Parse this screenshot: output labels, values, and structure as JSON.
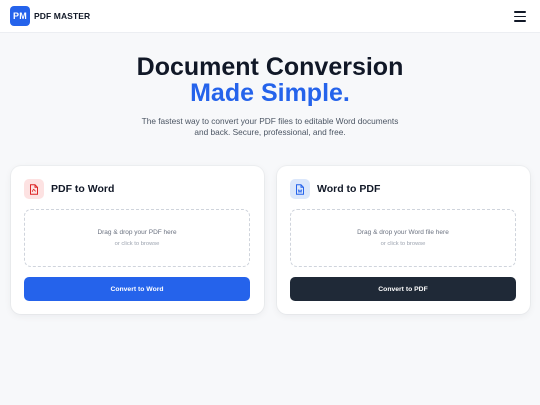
{
  "header": {
    "logo_badge": "PM",
    "logo_text": "PDF MASTER",
    "menu_icon": "hamburger-menu-icon"
  },
  "hero": {
    "title_line1": "Document Conversion",
    "title_line2": "Made Simple.",
    "subtitle_line1": "The fastest way to convert your PDF files to editable Word documents",
    "subtitle_line2": "and back. Secure, professional, and free."
  },
  "cards": {
    "pdf_to_word": {
      "icon": "pdf-file-icon",
      "title": "PDF to Word",
      "drop_text": "Drag & drop your PDF here",
      "browse_text": "or click to browse",
      "button_label": "Convert to Word"
    },
    "word_to_pdf": {
      "icon": "word-file-icon",
      "title": "Word to PDF",
      "drop_text": "Drag & drop your Word file here",
      "browse_text": "or click to browse",
      "button_label": "Convert to PDF"
    }
  },
  "colors": {
    "accent": "#2563eb",
    "dark_button": "#1f2937",
    "pdf_icon": "#dc2626",
    "word_icon": "#2563eb"
  }
}
